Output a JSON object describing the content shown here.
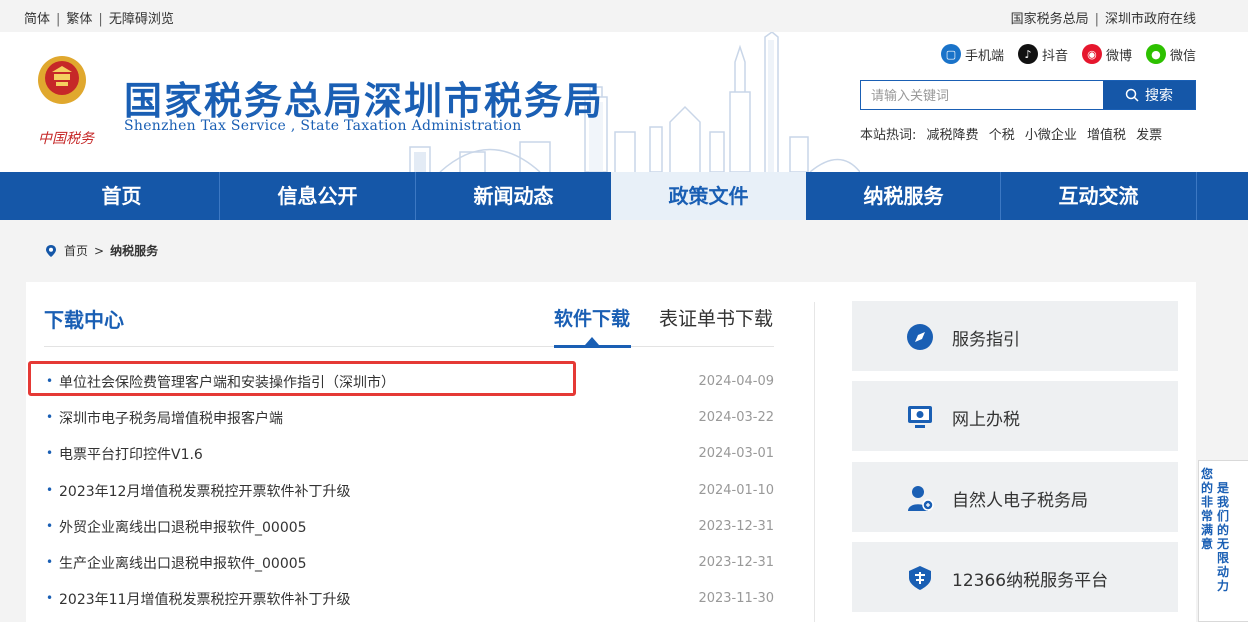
{
  "topbar": {
    "lang_simplified": "简体",
    "lang_traditional": "繁体",
    "accessibility": "无障碍浏览",
    "link_sat": "国家税务总局",
    "link_sz_gov": "深圳市政府在线"
  },
  "header": {
    "title_cn": "国家税务总局深圳市税务局",
    "title_en": "Shenzhen Tax Service , State Taxation Administration",
    "brand_sub": "中国税务",
    "social": {
      "mobile": "手机端",
      "douyin": "抖音",
      "weibo": "微博",
      "wechat": "微信"
    },
    "search": {
      "placeholder": "请输入关键词",
      "button": "搜索"
    },
    "hot": {
      "label": "本站热词:",
      "keywords": [
        "减税降费",
        "个税",
        "小微企业",
        "增值税",
        "发票"
      ]
    }
  },
  "nav": {
    "items": [
      "首页",
      "信息公开",
      "新闻动态",
      "政策文件",
      "纳税服务",
      "互动交流"
    ],
    "active": "政策文件"
  },
  "breadcrumb": {
    "home": "首页",
    "sep": ">",
    "current": "纳税服务"
  },
  "download": {
    "title": "下载中心",
    "tabs": [
      "软件下载",
      "表证单书下载"
    ],
    "items": [
      {
        "title": "单位社会保险费管理客户端和安装操作指引（深圳市）",
        "date": "2024-04-09"
      },
      {
        "title": "深圳市电子税务局增值税申报客户端",
        "date": "2024-03-22"
      },
      {
        "title": "电票平台打印控件V1.6",
        "date": "2024-03-01"
      },
      {
        "title": "2023年12月增值税发票税控开票软件补丁升级",
        "date": "2024-01-10"
      },
      {
        "title": "外贸企业离线出口退税申报软件_00005",
        "date": "2023-12-31"
      },
      {
        "title": "生产企业离线出口退税申报软件_00005",
        "date": "2023-12-31"
      },
      {
        "title": "2023年11月增值税发票税控开票软件补丁升级",
        "date": "2023-11-30"
      }
    ]
  },
  "services": [
    "服务指引",
    "网上办税",
    "自然人电子税务局",
    "12366纳税服务平台"
  ],
  "sidecard": {
    "col1": "您的非常满意",
    "col2": "是我们的无限动力"
  },
  "colors": {
    "primary": "#1557a8",
    "title_blue": "#1a5fb4",
    "highlight_red": "#e53935",
    "emblem_red": "#c62828",
    "gold": "#e0a82e"
  }
}
